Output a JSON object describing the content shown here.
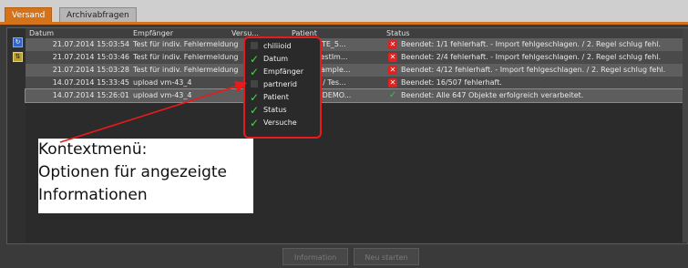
{
  "tabs": [
    {
      "label": "Versand",
      "active": true
    },
    {
      "label": "Archivabfragen",
      "active": false
    }
  ],
  "table": {
    "columns": {
      "date": "Datum",
      "recipient": "Empfänger",
      "attempts": "Versu...",
      "patient": "Patient",
      "status": "Status"
    },
    "rows": [
      {
        "date": "21.07.2014 15:03:54",
        "recipient": "Test für indiv. Fehlermeldung",
        "patient": "...ge SMPTE_5...",
        "status_icon": "error-icon",
        "status": "Beendet: 1/1 fehlerhaft. - Import fehlgeschlagen. / 2. Regel schlug fehl."
      },
      {
        "date": "21.07.2014 15:03:46",
        "recipient": "Test für indiv. Fehlermeldung",
        "patient": "...ANS / TestIm...",
        "status_icon": "error-icon",
        "status": "Beendet: 2/4 fehlerhaft. - Import fehlgeschlagen. / 2. Regel schlug fehl."
      },
      {
        "date": "21.07.2014 15:03:28",
        "recipient": "Test für indiv. Fehlermeldung",
        "patient": "...essedSample...",
        "status_icon": "error-icon",
        "status": "Beendet: 4/12 fehlerhaft. - Import fehlgeschlagen. / 2. Regel schlug fehl."
      },
      {
        "date": "14.07.2014 15:33:45",
        "recipient": "upload vm-43_4",
        "patient": "...ATIENT / Tes...",
        "status_icon": "error-icon",
        "status": "Beendet: 16/507 fehlerhaft."
      },
      {
        "date": "14.07.2014 15:26:01",
        "recipient": "upload vm-43_4",
        "patient": "...abine / DEMO...",
        "status_icon": "check-icon",
        "status": "Beendet: Alle 647 Objekte erfolgreich verarbeitet."
      }
    ]
  },
  "context_menu": {
    "items": [
      {
        "label": "chiliioid",
        "checked": false
      },
      {
        "label": "Datum",
        "checked": true
      },
      {
        "label": "Empfänger",
        "checked": true
      },
      {
        "label": "partnerid",
        "checked": false
      },
      {
        "label": "Patient",
        "checked": true
      },
      {
        "label": "Status",
        "checked": true
      },
      {
        "label": "Versuche",
        "checked": true
      }
    ]
  },
  "annotation": {
    "line1": "Kontextmenü:",
    "line2": "Optionen für angezeigte",
    "line3": "Informationen",
    "color": "#ea1a1a"
  },
  "buttons": {
    "information": "Information",
    "restart": "Neu starten"
  },
  "colors": {
    "accent": "#d4731a",
    "error": "#dd2222",
    "success": "#33cc33"
  }
}
